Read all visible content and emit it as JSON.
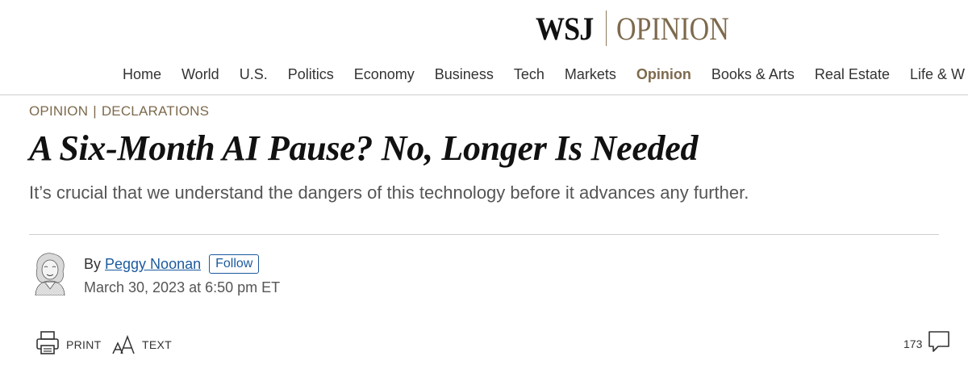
{
  "masthead": {
    "brand": "WSJ",
    "section": "OPINION"
  },
  "nav": {
    "items": [
      {
        "label": "Home"
      },
      {
        "label": "World"
      },
      {
        "label": "U.S."
      },
      {
        "label": "Politics"
      },
      {
        "label": "Economy"
      },
      {
        "label": "Business"
      },
      {
        "label": "Tech"
      },
      {
        "label": "Markets"
      },
      {
        "label": "Opinion",
        "active": true
      },
      {
        "label": "Books & Arts"
      },
      {
        "label": "Real Estate"
      },
      {
        "label": "Life & W"
      }
    ]
  },
  "article": {
    "kicker_section": "OPINION",
    "kicker_separator": "|",
    "kicker_column": "DECLARATIONS",
    "headline": "A Six-Month AI Pause? No, Longer Is Needed",
    "dek": "It’s crucial that we understand the dangers of this technology before it advances any further.",
    "byline_prefix": "By",
    "author": "Peggy Noonan",
    "follow_label": "Follow",
    "date": "March 30, 2023 at 6:50 pm ET"
  },
  "tools": {
    "print_label": "PRINT",
    "text_label": "TEXT",
    "comment_count": "173"
  },
  "colors": {
    "accent": "#7d6a4d",
    "link": "#1b5a9e",
    "text": "#111111",
    "muted": "#555555",
    "rule": "#cfcfcf"
  },
  "icons": {
    "print": "printer-icon",
    "text": "text-size-icon",
    "comments": "comment-bubble-icon",
    "avatar": "author-avatar"
  }
}
